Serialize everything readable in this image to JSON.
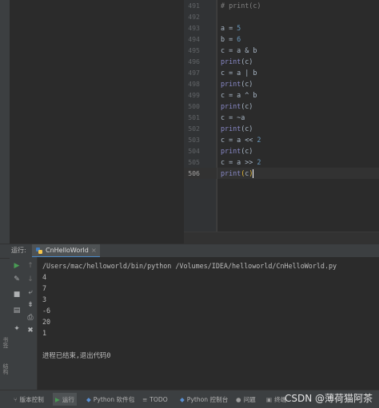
{
  "editor": {
    "lines": [
      {
        "num": "491",
        "text": "# print(c)",
        "kind": "comment"
      },
      {
        "num": "492",
        "text": "",
        "kind": "blank"
      },
      {
        "num": "493",
        "text": "a = 5",
        "kind": "code"
      },
      {
        "num": "494",
        "text": "b = 6",
        "kind": "code"
      },
      {
        "num": "495",
        "text": "c = a & b",
        "kind": "code"
      },
      {
        "num": "496",
        "text": "print(c)",
        "kind": "print"
      },
      {
        "num": "497",
        "text": "c = a | b",
        "kind": "code"
      },
      {
        "num": "498",
        "text": "print(c)",
        "kind": "print"
      },
      {
        "num": "499",
        "text": "c = a ^ b",
        "kind": "code"
      },
      {
        "num": "500",
        "text": "print(c)",
        "kind": "print"
      },
      {
        "num": "501",
        "text": "c = ~a",
        "kind": "code"
      },
      {
        "num": "502",
        "text": "print(c)",
        "kind": "print"
      },
      {
        "num": "503",
        "text": "c = a << 2",
        "kind": "code"
      },
      {
        "num": "504",
        "text": "print(c)",
        "kind": "print"
      },
      {
        "num": "505",
        "text": "c = a >> 2",
        "kind": "code"
      },
      {
        "num": "506",
        "text": "print(c)",
        "kind": "current"
      }
    ]
  },
  "run_panel": {
    "label": "运行:",
    "tab_label": "CnHelloWorld",
    "tab_close": "×",
    "console_lines": [
      "/Users/mac/helloworld/bin/python /Volumes/IDEA/helloworld/CnHelloWorld.py",
      "4",
      "7",
      "3",
      "-6",
      "20",
      "1",
      "",
      "进程已结束,退出代码0"
    ]
  },
  "left_strip": {
    "labels": [
      "书签",
      "结构"
    ]
  },
  "statusbar": {
    "items": [
      {
        "icon": "branch-icon",
        "glyph": "⑂",
        "label": "版本控制"
      },
      {
        "icon": "run-icon",
        "glyph": "▶",
        "label": "运行"
      },
      {
        "icon": "python-packages-icon",
        "glyph": "◆",
        "label": "Python 软件包"
      },
      {
        "icon": "todo-icon",
        "glyph": "≡",
        "label": "TODO"
      },
      {
        "icon": "python-console-icon",
        "glyph": "◆",
        "label": "Python 控制台"
      },
      {
        "icon": "problems-icon",
        "glyph": "●",
        "label": "问题"
      },
      {
        "icon": "terminal-icon",
        "glyph": "▣",
        "label": "终端"
      }
    ],
    "watermark": "CSDN @薄荷猫阿茶"
  },
  "colors": {
    "background": "#2b2b2b",
    "panel": "#3c3f41",
    "keyword": "#8888c6",
    "number": "#6897bb",
    "run_green": "#499c54",
    "tab_underline": "#4a88c7"
  }
}
